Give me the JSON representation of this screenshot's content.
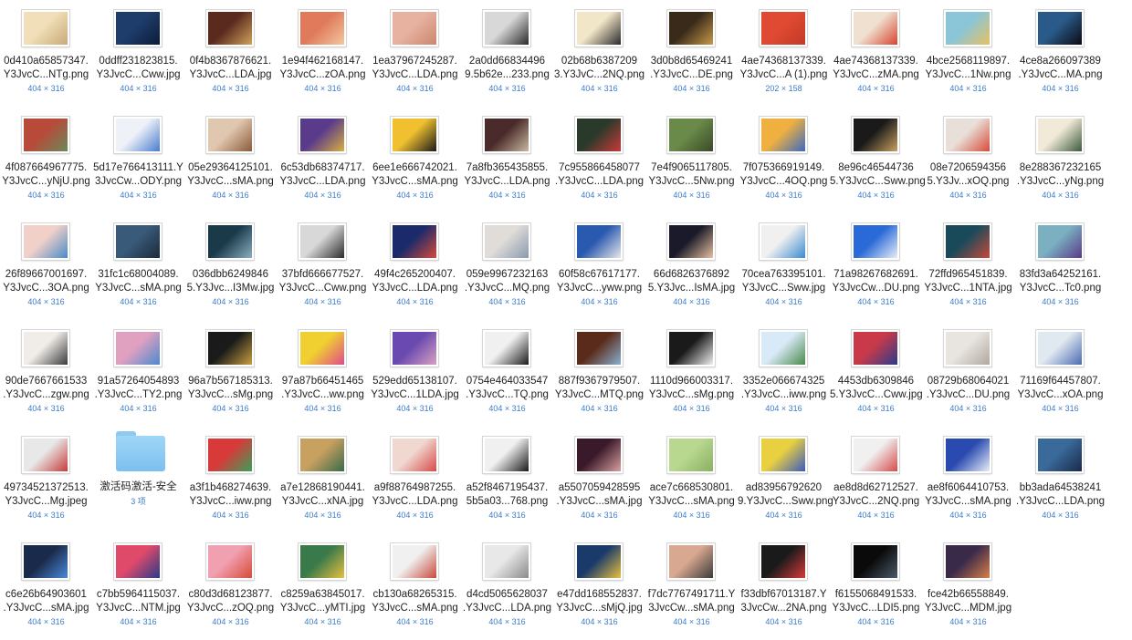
{
  "files": [
    {
      "line1": "0d410a65857347.",
      "line2": "Y3JvcC...NTg.png",
      "dim": "404 × 316",
      "c1": "#f0dfb8",
      "c2": "#c9a978"
    },
    {
      "line1": "0ddff231823815.",
      "line2": "Y3JvcC...Cww.jpg",
      "dim": "404 × 316",
      "c1": "#1f3d6b",
      "c2": "#0c1c38"
    },
    {
      "line1": "0f4b8367876621.",
      "line2": "Y3JvcC...LDA.jpg",
      "dim": "404 × 316",
      "c1": "#5a2a1e",
      "c2": "#d0a35a"
    },
    {
      "line1": "1e94f462168147.",
      "line2": "Y3JvcC...zOA.png",
      "dim": "404 × 316",
      "c1": "#e07a5a",
      "c2": "#f2c8a0"
    },
    {
      "line1": "1ea37967245287.",
      "line2": "Y3JvcC...LDA.png",
      "dim": "404 × 316",
      "c1": "#e8b2a0",
      "c2": "#c9876e"
    },
    {
      "line1": "2a0dd66834496",
      "line2": "9.5b62e...233.png",
      "dim": "404 × 316",
      "c1": "#d8d8d8",
      "c2": "#2a2a2a"
    },
    {
      "line1": "02b68b6387209",
      "line2": "3.Y3JvC...2NQ.png",
      "dim": "404 × 316",
      "c1": "#f2e6c8",
      "c2": "#2a2a2a"
    },
    {
      "line1": "3d0b8d65469241",
      "line2": ".Y3JvcC...DE.png",
      "dim": "404 × 316",
      "c1": "#3a2a1a",
      "c2": "#c89a4a"
    },
    {
      "line1": "4ae74368137339.",
      "line2": "Y3JvcC...A (1).png",
      "dim": "202 × 158",
      "c1": "#e04a32",
      "c2": "#c23a28"
    },
    {
      "line1": "4ae74368137339.",
      "line2": "Y3JvcC...zMA.png",
      "dim": "404 × 316",
      "c1": "#f0e0d0",
      "c2": "#d8432e"
    },
    {
      "line1": "4bce2568119897.",
      "line2": "Y3JvcC...1Nw.png",
      "dim": "404 × 316",
      "c1": "#8ac6d8",
      "c2": "#e8c060"
    },
    {
      "line1": "4ce8a266097389",
      "line2": ".Y3JvcC...MA.png",
      "dim": "404 × 316",
      "c1": "#2a5a8a",
      "c2": "#0a0a12"
    },
    {
      "line1": "4f087664967775.",
      "line2": "Y3JvcC...yNjU.png",
      "dim": "404 × 316",
      "c1": "#b84a3a",
      "c2": "#6a8a5a"
    },
    {
      "line1": "5d17e766413111.Y",
      "line2": "3JvcCw...ODY.png",
      "dim": "404 × 316",
      "c1": "#eef2f8",
      "c2": "#4a7ad0"
    },
    {
      "line1": "05e29364125101.",
      "line2": "Y3JvcC...sMA.png",
      "dim": "404 × 316",
      "c1": "#e0c8b0",
      "c2": "#8a5a3a"
    },
    {
      "line1": "6c53db68374717.",
      "line2": "Y3JvcC...LDA.png",
      "dim": "404 × 316",
      "c1": "#5a3a8a",
      "c2": "#d8b040"
    },
    {
      "line1": "6ee1e666742021.",
      "line2": "Y3JvcC...sMA.png",
      "dim": "404 × 316",
      "c1": "#f0c030",
      "c2": "#1a1a1a"
    },
    {
      "line1": "7a8fb365435855.",
      "line2": "Y3JvcC...LDA.png",
      "dim": "404 × 316",
      "c1": "#4a2a2a",
      "c2": "#c8b8a0"
    },
    {
      "line1": "7c955866458077",
      "line2": ".Y3JvcC...LDA.png",
      "dim": "404 × 316",
      "c1": "#2a3a2a",
      "c2": "#c83a3a"
    },
    {
      "line1": "7e4f9065117805.",
      "line2": "Y3JvcC...5Nw.png",
      "dim": "404 × 316",
      "c1": "#6a8a4a",
      "c2": "#3a4a2a"
    },
    {
      "line1": "7f075366919149.",
      "line2": "Y3JvcC...4OQ.png",
      "dim": "404 × 316",
      "c1": "#f0b040",
      "c2": "#3a6ac0"
    },
    {
      "line1": "8e96c46544736",
      "line2": "5.Y3JvcC...Sww.png",
      "dim": "404 × 316",
      "c1": "#1a1a1a",
      "c2": "#c8a060"
    },
    {
      "line1": "08e7206594356",
      "line2": "5.Y3Jv...xOQ.png",
      "dim": "404 × 316",
      "c1": "#e8e0d8",
      "c2": "#d84a3a"
    },
    {
      "line1": "8e288367232165",
      "line2": ".Y3JvcC...yNg.png",
      "dim": "404 × 316",
      "c1": "#f2ead8",
      "c2": "#3a5a3a"
    },
    {
      "line1": "26f89667001697.",
      "line2": "Y3JvcC...3OA.png",
      "dim": "404 × 316",
      "c1": "#f0d0c8",
      "c2": "#4a8ac8"
    },
    {
      "line1": "31fc1c68004089.",
      "line2": "Y3JvcC...sMA.png",
      "dim": "404 × 316",
      "c1": "#3a5a7a",
      "c2": "#1a2a3a"
    },
    {
      "line1": "036dbb6249846",
      "line2": "5.Y3Jvc...I3Mw.jpg",
      "dim": "404 × 316",
      "c1": "#1a3a4a",
      "c2": "#8ab0c0"
    },
    {
      "line1": "37bfd666677527.",
      "line2": "Y3JvcC...Cww.png",
      "dim": "404 × 316",
      "c1": "#d8d8d8",
      "c2": "#2a2a2a"
    },
    {
      "line1": "49f4c265200407.",
      "line2": "Y3JvcC...LDA.png",
      "dim": "404 × 316",
      "c1": "#1a2a6a",
      "c2": "#d84a3a"
    },
    {
      "line1": "059e9967232163",
      "line2": ".Y3JvcC...MQ.png",
      "dim": "404 × 316",
      "c1": "#e0dcd8",
      "c2": "#8a9ab0"
    },
    {
      "line1": "60f58c67617177.",
      "line2": "Y3JvcC...yww.png",
      "dim": "404 × 316",
      "c1": "#2a5ab0",
      "c2": "#e8e8e8"
    },
    {
      "line1": "66d6826376892",
      "line2": "5.Y3Jvc...IsMA.jpg",
      "dim": "404 × 316",
      "c1": "#1a1a2a",
      "c2": "#e8c0a0"
    },
    {
      "line1": "70cea763395101.",
      "line2": "Y3JvcC...Sww.jpg",
      "dim": "404 × 316",
      "c1": "#f0f0f0",
      "c2": "#3a8ad0"
    },
    {
      "line1": "71a98267682691.",
      "line2": "Y3JvcCw...DU.png",
      "dim": "404 × 316",
      "c1": "#2a6ad8",
      "c2": "#e8eef8"
    },
    {
      "line1": "72ffd965451839.",
      "line2": "Y3JvcC...1NTA.jpg",
      "dim": "404 × 316",
      "c1": "#1a4a5a",
      "c2": "#c84a3a"
    },
    {
      "line1": "83fd3a64252161.",
      "line2": "Y3JvcC...Tc0.png",
      "dim": "404 × 316",
      "c1": "#7ab0c0",
      "c2": "#5a3a8a"
    },
    {
      "line1": "90de7667661533",
      "line2": ".Y3JvcC...zgw.png",
      "dim": "404 × 316",
      "c1": "#f0ece8",
      "c2": "#3a3a3a"
    },
    {
      "line1": "91a57264054893",
      "line2": ".Y3JvcC...TY2.png",
      "dim": "404 × 316",
      "c1": "#e0a0c0",
      "c2": "#4a8ad0"
    },
    {
      "line1": "96a7b567185313.",
      "line2": "Y3JvcC...sMg.png",
      "dim": "404 × 316",
      "c1": "#1a1a1a",
      "c2": "#c8a040"
    },
    {
      "line1": "97a87b66451465",
      "line2": ".Y3JvcC...ww.png",
      "dim": "404 × 316",
      "c1": "#f0d030",
      "c2": "#e04a8a"
    },
    {
      "line1": "529edd65138107.",
      "line2": "Y3JvcC...1LDA.jpg",
      "dim": "404 × 316",
      "c1": "#6a4ab0",
      "c2": "#d8a0c0"
    },
    {
      "line1": "0754e464033547",
      "line2": ".Y3JvcC...TQ.png",
      "dim": "404 × 316",
      "c1": "#f0f0f0",
      "c2": "#1a1a1a"
    },
    {
      "line1": "887f9367979507.",
      "line2": "Y3JvcC...MTQ.png",
      "dim": "404 × 316",
      "c1": "#5a2a1a",
      "c2": "#8ab0d0"
    },
    {
      "line1": "1110d966003317.",
      "line2": "Y3JvcC...sMg.png",
      "dim": "404 × 316",
      "c1": "#1a1a1a",
      "c2": "#f0f0f0"
    },
    {
      "line1": "3352e066674325",
      "line2": ".Y3JvcC...iww.png",
      "dim": "404 × 316",
      "c1": "#d8eaf8",
      "c2": "#4a8a4a"
    },
    {
      "line1": "4453db6309846",
      "line2": "5.Y3JvcC...Cww.jpg",
      "dim": "404 × 316",
      "c1": "#c83a4a",
      "c2": "#2a3a8a"
    },
    {
      "line1": "08729b68064021",
      "line2": ".Y3JvcC...DU.png",
      "dim": "404 × 316",
      "c1": "#e8e4e0",
      "c2": "#b0a8a0"
    },
    {
      "line1": "71169f64457807.",
      "line2": "Y3JvcC...xOA.png",
      "dim": "404 × 316",
      "c1": "#e0e8f0",
      "c2": "#4a6ab0"
    },
    {
      "line1": "49734521372513.",
      "line2": "Y3JvcC...Mg.jpeg",
      "dim": "404 × 316",
      "c1": "#e8e8e8",
      "c2": "#c83a3a"
    },
    {
      "folder": true,
      "line1": "激活码激活-安全",
      "line2": "",
      "dim": "3 项"
    },
    {
      "line1": "a3f1b468274639.",
      "line2": "Y3JvcC...iww.png",
      "dim": "404 × 316",
      "c1": "#d83a3a",
      "c2": "#3aa05a"
    },
    {
      "line1": "a7e12868190441.",
      "line2": "Y3JvcC...xNA.jpg",
      "dim": "404 × 316",
      "c1": "#c8a060",
      "c2": "#3a6a4a"
    },
    {
      "line1": "a9f88764987255.",
      "line2": "Y3JvcC...LDA.png",
      "dim": "404 × 316",
      "c1": "#f0d8d0",
      "c2": "#d84a4a"
    },
    {
      "line1": "a52f8467195437.",
      "line2": "5b5a03...768.png",
      "dim": "404 × 316",
      "c1": "#f0f0f0",
      "c2": "#1a1a1a"
    },
    {
      "line1": "a5507059428595",
      "line2": ".Y3JvcC...sMA.jpg",
      "dim": "404 × 316",
      "c1": "#3a1a2a",
      "c2": "#d8a0a0"
    },
    {
      "line1": "ace7c668530801.",
      "line2": "Y3JvcC...sMA.png",
      "dim": "404 × 316",
      "c1": "#b8d890",
      "c2": "#8ab060"
    },
    {
      "line1": "ad83956792620",
      "line2": "9.Y3JvcC...Sww.png",
      "dim": "404 × 316",
      "c1": "#e8d040",
      "c2": "#3a5ac0"
    },
    {
      "line1": "ae8d8d62712527.",
      "line2": "Y3JvcC...2NQ.png",
      "dim": "404 × 316",
      "c1": "#f0f0f0",
      "c2": "#d84a4a"
    },
    {
      "line1": "ae8f6064410753.",
      "line2": "Y3JvcC...sMA.png",
      "dim": "404 × 316",
      "c1": "#2a4ab0",
      "c2": "#e8eef8"
    },
    {
      "line1": "bb3ada64538241",
      "line2": ".Y3JvcC...LDA.png",
      "dim": "404 × 316",
      "c1": "#3a6a9a",
      "c2": "#1a2a4a"
    },
    {
      "line1": "c6e26b64903601",
      "line2": ".Y3JvcC...sMA.jpg",
      "dim": "404 × 316",
      "c1": "#1a2a4a",
      "c2": "#4a8ad8"
    },
    {
      "line1": "c7bb5964115037.",
      "line2": "Y3JvcC...NTM.jpg",
      "dim": "404 × 316",
      "c1": "#e04a6a",
      "c2": "#2a3a8a"
    },
    {
      "line1": "c80d3d68123877.",
      "line2": "Y3JvcC...zOQ.png",
      "dim": "404 × 316",
      "c1": "#f0a0b0",
      "c2": "#d84a3a"
    },
    {
      "line1": "c8259a63845017.",
      "line2": "Y3JvcC...yMTI.jpg",
      "dim": "404 × 316",
      "c1": "#3a7a4a",
      "c2": "#e8c040"
    },
    {
      "line1": "cb130a68265315.",
      "line2": "Y3JvcC...sMA.png",
      "dim": "404 × 316",
      "c1": "#f0f0f0",
      "c2": "#c84a3a"
    },
    {
      "line1": "d4cd5065628037",
      "line2": ".Y3JvcC...LDA.png",
      "dim": "404 × 316",
      "c1": "#e8e8e8",
      "c2": "#8a8a8a"
    },
    {
      "line1": "e47dd168552837.",
      "line2": "Y3JvcC...sMjQ.jpg",
      "dim": "404 × 316",
      "c1": "#1a3a6a",
      "c2": "#e8c040"
    },
    {
      "line1": "f7dc7767491711.Y",
      "line2": "3JvcCw...sMA.png",
      "dim": "404 × 316",
      "c1": "#d8a890",
      "c2": "#3a3a3a"
    },
    {
      "line1": "f33dbf67013187.Y",
      "line2": "3JvcCw...2NA.png",
      "dim": "404 × 316",
      "c1": "#1a1a1a",
      "c2": "#d83a3a"
    },
    {
      "line1": "f6155068491533.",
      "line2": "Y3JvcC...LDI5.png",
      "dim": "404 × 316",
      "c1": "#0a0a0a",
      "c2": "#4a5a6a"
    },
    {
      "line1": "fce42b66558849.",
      "line2": "Y3JvcC...MDM.jpg",
      "dim": "404 × 316",
      "c1": "#3a2a4a",
      "c2": "#d8804a"
    }
  ]
}
